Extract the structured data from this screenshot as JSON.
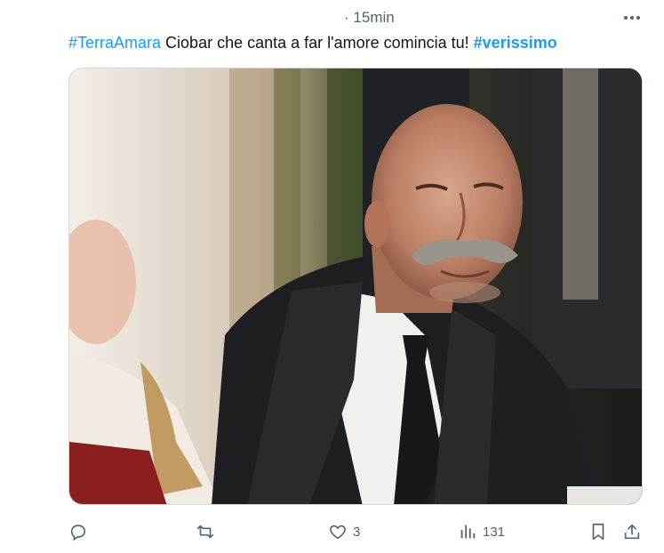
{
  "tweet": {
    "time_separator": "·",
    "time": "15min",
    "text": {
      "hashtag1": "#TerraAmara",
      "body": " Ciobar che canta  a far l'amore comincia tu! ",
      "hashtag2": "#verissimo"
    }
  },
  "media": {
    "description_icon": "photo-still"
  },
  "actions": {
    "reply": {
      "icon": "reply-icon",
      "count": ""
    },
    "retweet": {
      "icon": "retweet-icon",
      "count": ""
    },
    "like": {
      "icon": "heart-icon",
      "count": "3"
    },
    "views": {
      "icon": "views-icon",
      "count": "131"
    },
    "bookmark": {
      "icon": "bookmark-icon"
    },
    "share": {
      "icon": "share-icon"
    }
  },
  "colors": {
    "accent": "#1d9bf0",
    "secondary_text": "#536471"
  }
}
